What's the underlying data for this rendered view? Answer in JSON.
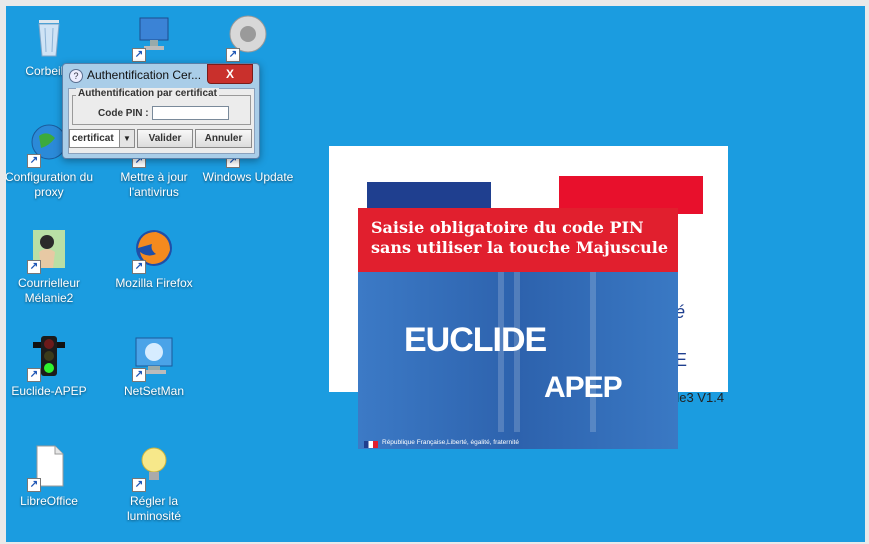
{
  "desktop": {
    "icons": [
      {
        "label": "Corbeille",
        "icon": "recycle-bin-icon"
      },
      {
        "label": "",
        "icon": "computer-icon"
      },
      {
        "label": "",
        "icon": "speaker-icon"
      },
      {
        "label": "Configuration du proxy",
        "icon": "globe-icon"
      },
      {
        "label": "Mettre à jour l'antivirus",
        "icon": "antivirus-icon"
      },
      {
        "label": "Windows Update",
        "icon": "update-icon"
      },
      {
        "label": "Courrielleur Mélanie2",
        "icon": "mail-client-icon"
      },
      {
        "label": "Mozilla Firefox",
        "icon": "firefox-icon"
      },
      {
        "label": "Euclide-APEP",
        "icon": "traffic-light-icon"
      },
      {
        "label": "NetSetMan",
        "icon": "network-monitor-icon"
      },
      {
        "label": "LibreOffice",
        "icon": "libreoffice-icon"
      },
      {
        "label": "Régler la luminosité",
        "icon": "lightbulb-icon"
      }
    ]
  },
  "splash": {
    "banner": "Saisie obligatoire du code PIN sans utiliser la touche Majuscule",
    "brand_line1": "EUCLIDE",
    "brand_line2": "APEP",
    "footer": "République Française,Liberté, égalité, fraternité",
    "back_version": "de3 V1.4",
    "back_letter": "E",
    "back_italic_letter": "é"
  },
  "dialog": {
    "title": "Authentification Cer...",
    "close_label": "X",
    "group_legend": "Authentification par certificat",
    "pin_label": "Code PIN :",
    "pin_value": "",
    "select_value": "certificat",
    "validate_label": "Valider",
    "cancel_label": "Annuler"
  }
}
